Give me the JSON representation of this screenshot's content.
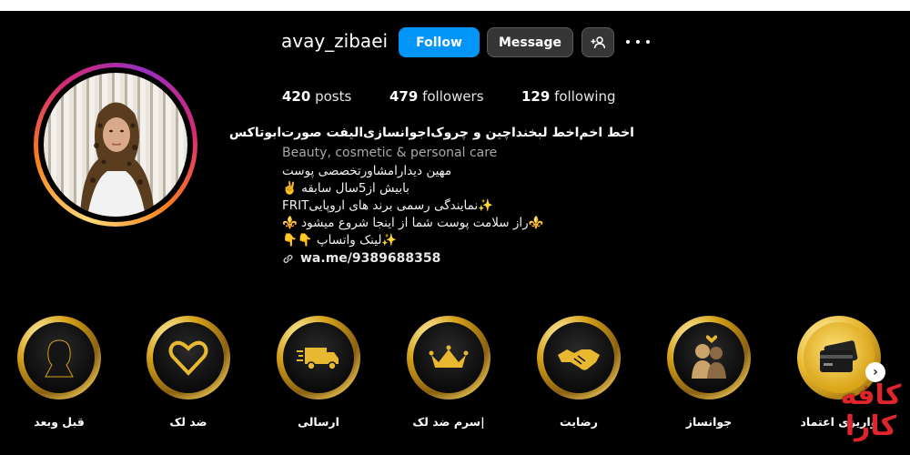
{
  "profile": {
    "username": "avay_zibaei",
    "follow_label": "Follow",
    "message_label": "Message",
    "posts_count": "420",
    "posts_label": "posts",
    "followers_count": "479",
    "followers_label": "followers",
    "following_count": "129",
    "following_label": "following"
  },
  "bio": {
    "name": "اخط اخم‌اخط لبخنداچین و چروک‌اجوانسازی‌الیفت صورت‌ابوتاکس",
    "category": "Beauty, cosmetic & personal care",
    "lines": [
      "مهین دیدار‌امشاورتخصصی پوست",
      "بابیش از5سال سابقه ✌️",
      "✨نمایندگی رسمی برند های اروپاییFRIT",
      "⚜️راز سلامت پوست شما از اینجا شروع میشود ⚜️",
      "✨لینک واتساپ 👇👇"
    ],
    "link": "wa.me/9389688358"
  },
  "highlights": [
    {
      "label": "قبل وبعد",
      "icon": "woman-silhouette-icon"
    },
    {
      "label": "ضد لک",
      "icon": "heart-icon"
    },
    {
      "label": "ارسالی",
      "icon": "delivery-truck-icon"
    },
    {
      "label": "|سرم ضد لک",
      "icon": "crown-icon"
    },
    {
      "label": "رضایت",
      "icon": "handshake-icon"
    },
    {
      "label": "جوانساز",
      "icon": "couple-icon"
    },
    {
      "label": "واریزی اعتماد",
      "icon": "credit-card-icon"
    }
  ],
  "watermark": {
    "line1": "کافه",
    "line2": "کارا"
  },
  "colors": {
    "accent": "#0095f6",
    "gold": "#d4a017",
    "watermark": "#e0242c"
  }
}
